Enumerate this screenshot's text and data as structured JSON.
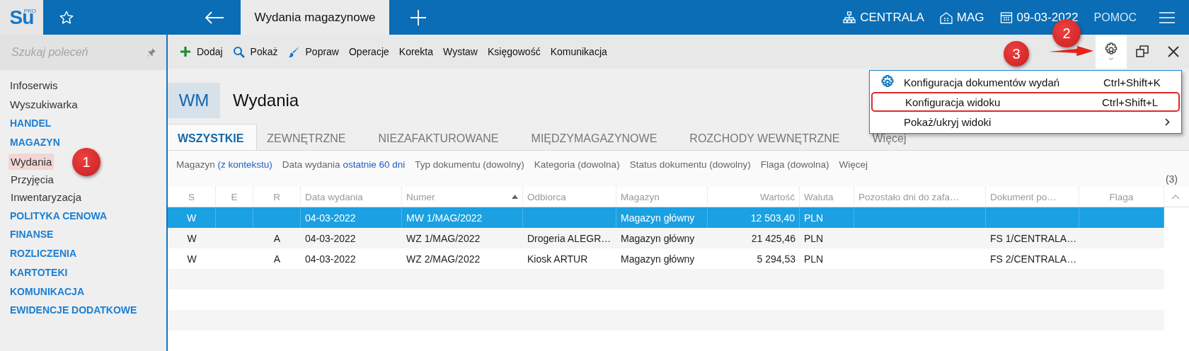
{
  "header": {
    "logo": "Su",
    "logo_badge": "PRO",
    "tab": "Wydania magazynowe",
    "context": [
      {
        "kind": "branch",
        "label": "CENTRALA"
      },
      {
        "kind": "store",
        "label": "MAG"
      },
      {
        "kind": "date",
        "label": "09-03-2022"
      }
    ],
    "help": "POMOC"
  },
  "sidebar": {
    "search": {
      "placeholder": "Szukaj poleceń"
    },
    "items": [
      {
        "label": "Infoserwis",
        "kind": "link",
        "selected": false
      },
      {
        "label": "Wyszukiwarka",
        "kind": "link",
        "selected": false
      },
      {
        "label": "HANDEL",
        "kind": "section",
        "selected": false
      },
      {
        "label": "MAGAZYN",
        "kind": "section",
        "selected": false,
        "children": [
          {
            "label": "Wydania",
            "kind": "link",
            "selected": true
          },
          {
            "label": "Przyjęcia",
            "kind": "link",
            "selected": false
          },
          {
            "label": "Inwentaryzacja",
            "kind": "link",
            "selected": false
          }
        ]
      },
      {
        "label": "POLITYKA CENOWA",
        "kind": "section",
        "selected": false
      },
      {
        "label": "FINANSE",
        "kind": "section",
        "selected": false
      },
      {
        "label": "ROZLICZENIA",
        "kind": "section",
        "selected": false
      },
      {
        "label": "KARTOTEKI",
        "kind": "section",
        "selected": false
      },
      {
        "label": "KOMUNIKACJA",
        "kind": "section",
        "selected": false
      },
      {
        "label": "EWIDENCJE DODATKOWE",
        "kind": "section",
        "selected": false
      }
    ]
  },
  "toolbar": {
    "actions": [
      {
        "label": "Dodaj",
        "kind": "plus"
      },
      {
        "label": "Pokaż",
        "kind": "search"
      },
      {
        "label": "Popraw",
        "kind": "brush"
      },
      {
        "label": "Operacje",
        "kind": "text"
      },
      {
        "label": "Korekta",
        "kind": "text"
      },
      {
        "label": "Wystaw",
        "kind": "text"
      },
      {
        "label": "Księgowość",
        "kind": "text"
      },
      {
        "label": "Komunikacja",
        "kind": "text"
      }
    ],
    "settings_open": true
  },
  "settings_menu": [
    {
      "label": "Konfiguracja dokumentów wydań",
      "shortcut": "Ctrl+Shift+K",
      "kind": "gear",
      "highlighted": false
    },
    {
      "label": "Konfiguracja widoku",
      "shortcut": "Ctrl+Shift+L",
      "kind": "plain",
      "highlighted": true
    },
    {
      "label": "Pokaż/ukryj widoki",
      "kind": "submenu",
      "highlighted": false
    }
  ],
  "page": {
    "code": "WM",
    "title": "Wydania"
  },
  "tabs": [
    {
      "label": "WSZYSTKIE",
      "selected": true
    },
    {
      "label": "ZEWNĘTRZNE",
      "selected": false
    },
    {
      "label": "NIEZAFAKTUROWANE",
      "selected": false
    },
    {
      "label": "MIĘDZYMAGAZYNOWE",
      "selected": false
    },
    {
      "label": "ROZCHODY WEWNĘTRZNE",
      "selected": false
    },
    {
      "label": "Więcej",
      "selected": false
    }
  ],
  "filters": [
    {
      "label": "Magazyn",
      "value": "(z kontekstu)",
      "active": true
    },
    {
      "label": "Data wydania",
      "value": "ostatnie 60 dni",
      "active": true
    },
    {
      "label": "Typ dokumentu",
      "value": "(dowolny)",
      "active": false
    },
    {
      "label": "Kategoria",
      "value": "(dowolna)",
      "active": false
    },
    {
      "label": "Status dokumentu",
      "value": "(dowolny)",
      "active": false
    },
    {
      "label": "Flaga",
      "value": "(dowolna)",
      "active": false
    }
  ],
  "filters_more": "Więcej",
  "count": "(3)",
  "table": {
    "columns": [
      {
        "label": "S",
        "sorted": false
      },
      {
        "label": "E",
        "sorted": false
      },
      {
        "label": "R",
        "sorted": false
      },
      {
        "label": "Data wydania",
        "sorted": false
      },
      {
        "label": "Numer",
        "sorted": true
      },
      {
        "label": "Odbiorca",
        "sorted": false
      },
      {
        "label": "Magazyn",
        "sorted": false
      },
      {
        "label": "Wartość",
        "sorted": false
      },
      {
        "label": "Waluta",
        "sorted": false
      },
      {
        "label": "Pozostało dni do zafa…",
        "sorted": false
      },
      {
        "label": "Dokument po…",
        "sorted": false
      },
      {
        "label": "Flaga",
        "sorted": false
      }
    ],
    "rows": [
      {
        "selected": true,
        "cells": [
          "W",
          null,
          null,
          "04-03-2022",
          "MW 1/MAG/2022",
          null,
          "Magazyn główny",
          "12 503,40",
          "PLN",
          null,
          null,
          null
        ]
      },
      {
        "selected": false,
        "cells": [
          "W",
          null,
          "A",
          "04-03-2022",
          "WZ 1/MAG/2022",
          "Drogeria ALEGR…",
          "Magazyn główny",
          "21 425,46",
          "PLN",
          null,
          "FS 1/CENTRALA…",
          null
        ]
      },
      {
        "selected": false,
        "cells": [
          "W",
          null,
          "A",
          "04-03-2022",
          "WZ 2/MAG/2022",
          "Kiosk ARTUR",
          "Magazyn główny",
          "5 294,53",
          "PLN",
          null,
          "FS 2/CENTRALA…",
          null
        ]
      }
    ]
  },
  "annotations": [
    {
      "label": "1"
    },
    {
      "label": "2"
    },
    {
      "label": "3"
    }
  ]
}
